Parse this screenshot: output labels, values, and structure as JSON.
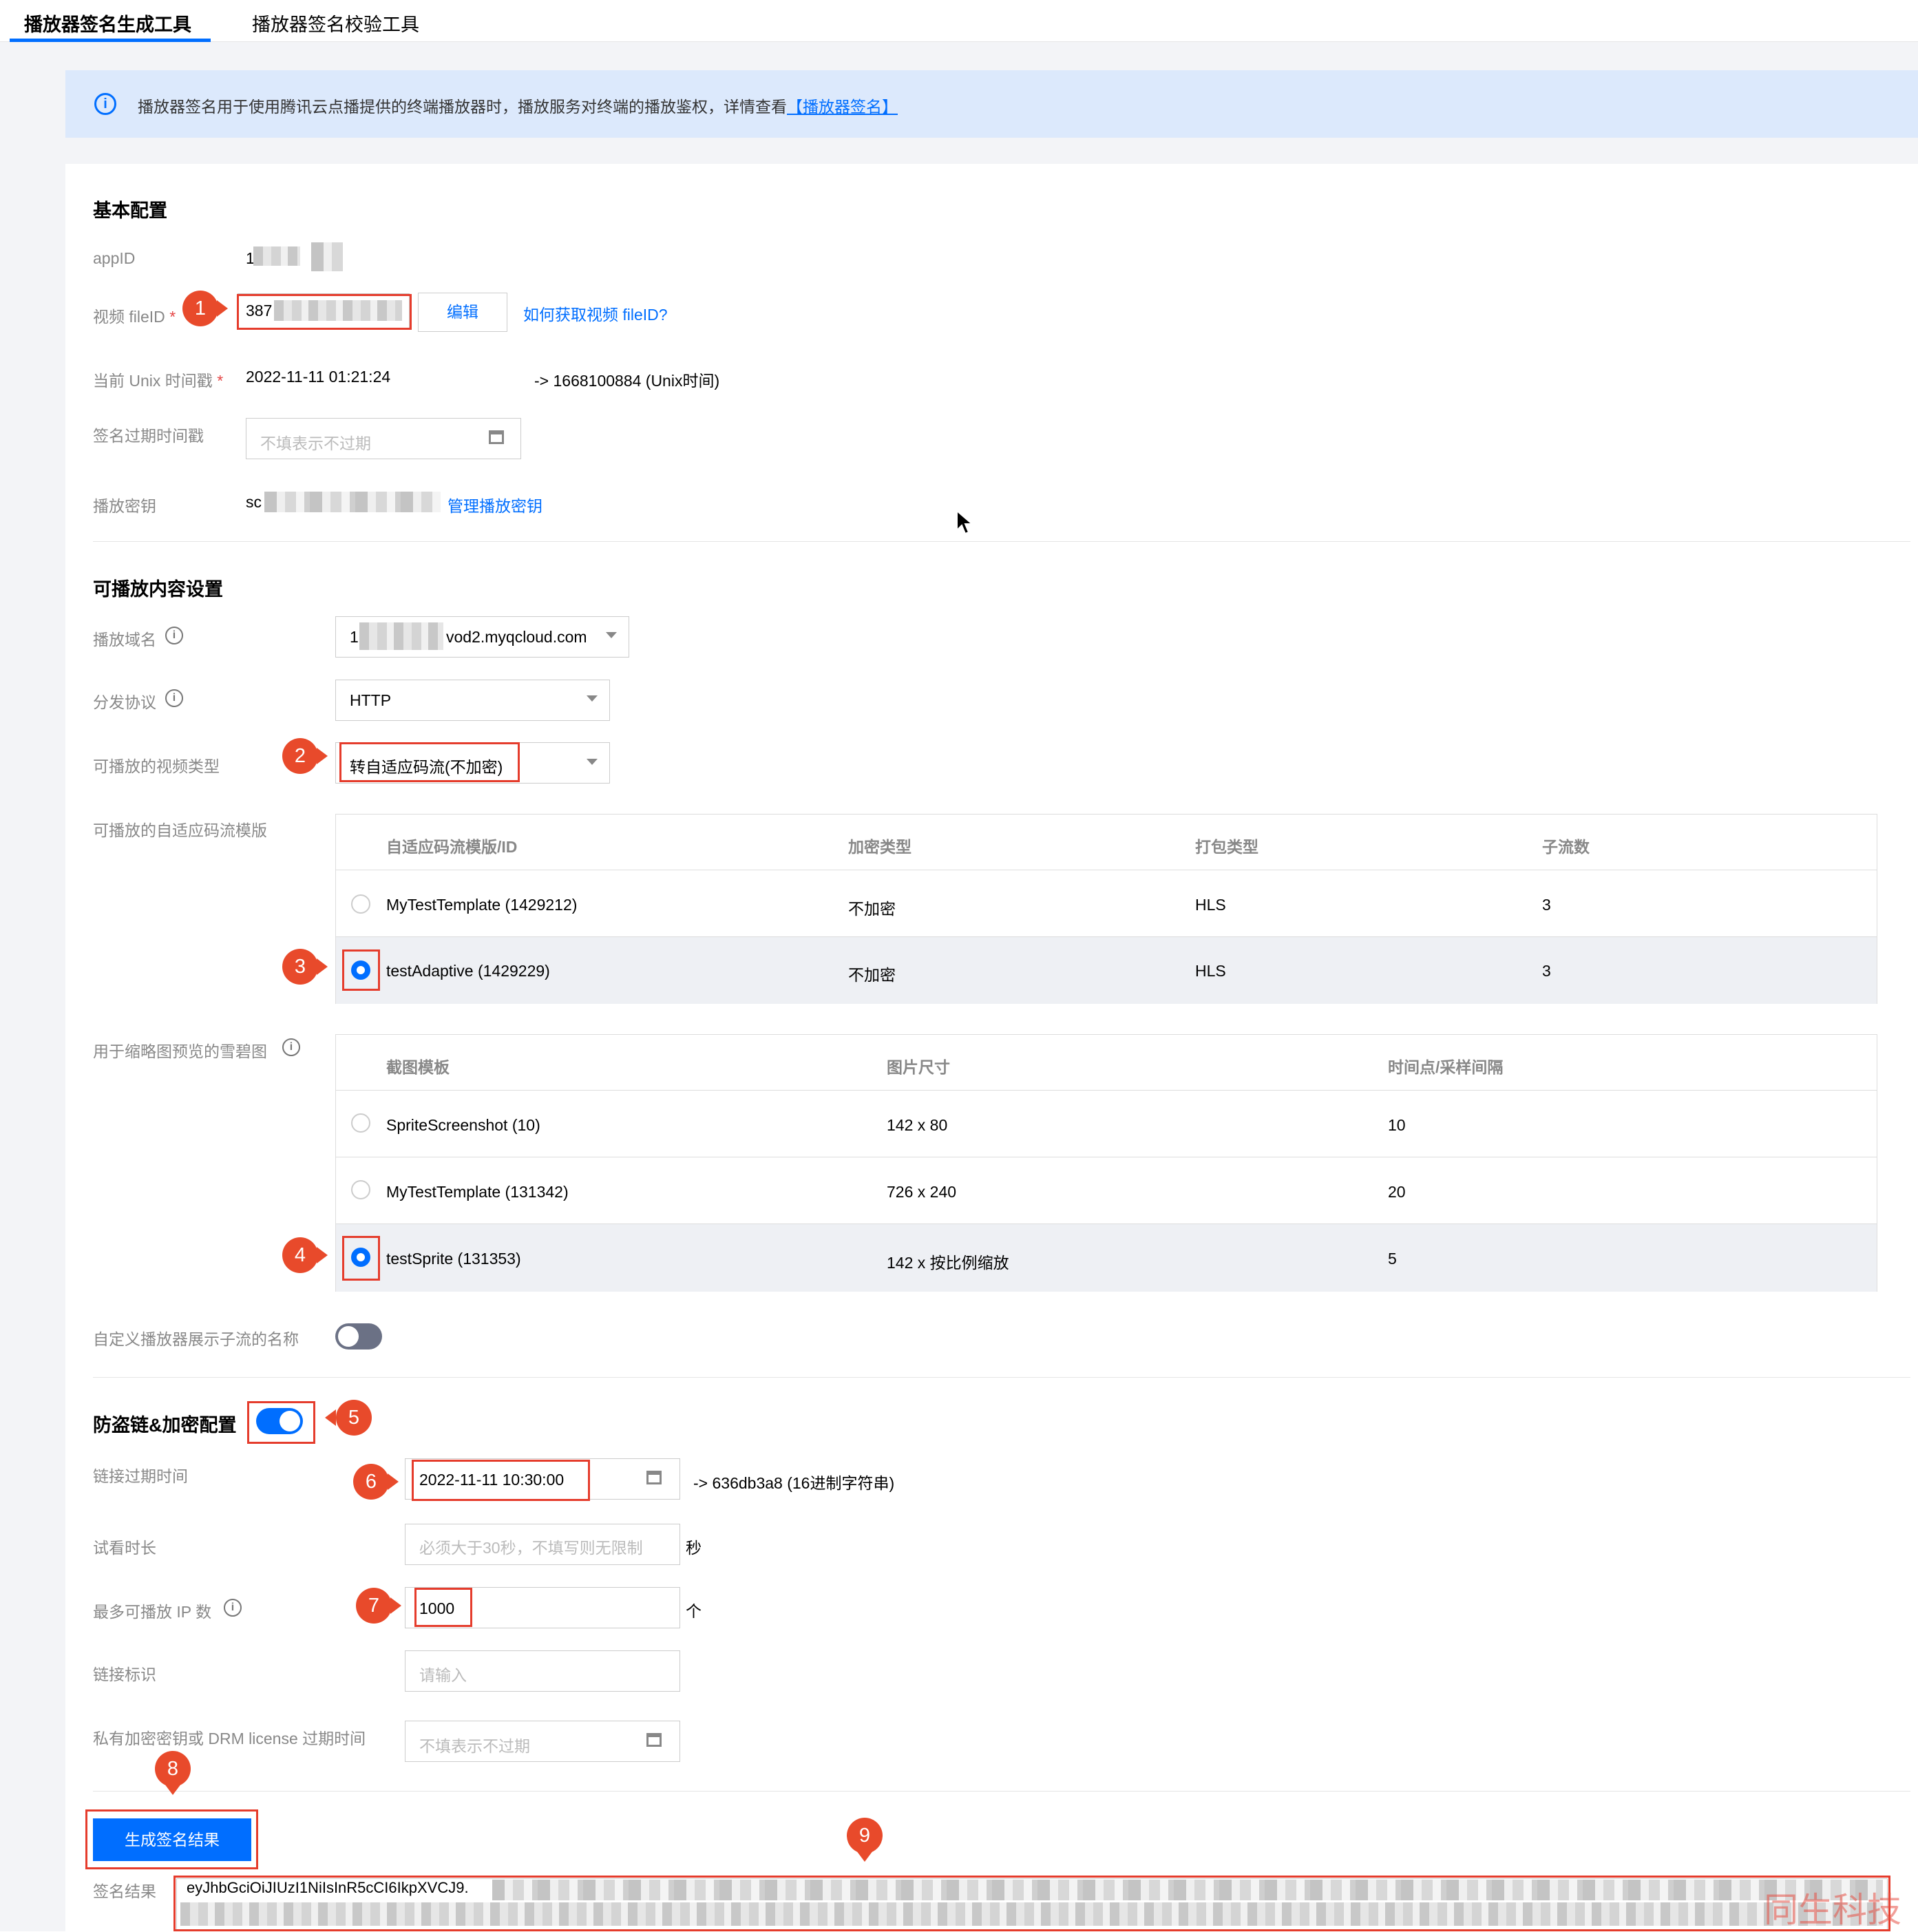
{
  "tabs": {
    "active": "播放器签名生成工具",
    "other": "播放器签名校验工具"
  },
  "banner": {
    "text": "播放器签名用于使用腾讯云点播提供的终端播放器时，播放服务对终端的播放鉴权，详情查看",
    "link": "【播放器签名】"
  },
  "basic": {
    "title": "基本配置",
    "appid_label": "appID",
    "appid_value": "1",
    "fileid_label": "视频 fileID",
    "fileid_value": "387",
    "edit_button": "编辑",
    "fileid_help": "如何获取视频 fileID?",
    "unix_label": "当前 Unix 时间戳",
    "unix_value": "2022-11-11 01:21:24",
    "unix_converted": "-> 1668100884 (Unix时间)",
    "expire_label": "签名过期时间戳",
    "expire_placeholder": "不填表示不过期",
    "key_label": "播放密钥",
    "key_value": "sc",
    "key_manage": "管理播放密钥"
  },
  "content": {
    "title": "可播放内容设置",
    "domain_label": "播放域名",
    "domain_value_prefix": "1",
    "domain_value": "vod2.myqcloud.com",
    "protocol_label": "分发协议",
    "protocol_value": "HTTP",
    "type_label": "可播放的视频类型",
    "type_value": "转自适应码流(不加密)",
    "template_label": "可播放的自适应码流模版",
    "template_table": {
      "headers": [
        "自适应码流模版/ID",
        "加密类型",
        "打包类型",
        "子流数"
      ],
      "rows": [
        {
          "name": "MyTestTemplate (1429212)",
          "enc": "不加密",
          "pack": "HLS",
          "streams": "3",
          "selected": false
        },
        {
          "name": "testAdaptive (1429229)",
          "enc": "不加密",
          "pack": "HLS",
          "streams": "3",
          "selected": true
        }
      ]
    },
    "sprite_label": "用于缩略图预览的雪碧图",
    "sprite_table": {
      "headers": [
        "截图模板",
        "图片尺寸",
        "时间点/采样间隔"
      ],
      "rows": [
        {
          "name": "SpriteScreenshot (10)",
          "size": "142 x 80",
          "interval": "10",
          "selected": false
        },
        {
          "name": "MyTestTemplate (131342)",
          "size": "726 x 240",
          "interval": "20",
          "selected": false
        },
        {
          "name": "testSprite (131353)",
          "size": "142 x 按比例缩放",
          "interval": "5",
          "selected": true
        }
      ]
    },
    "custom_name_label": "自定义播放器展示子流的名称",
    "custom_name_toggle": "off"
  },
  "security": {
    "title": "防盗链&加密配置",
    "toggle": "on",
    "link_expire_label": "链接过期时间",
    "link_expire_value": "2022-11-11 10:30:00",
    "link_expire_hex": "-> 636db3a8 (16进制字符串)",
    "trial_label": "试看时长",
    "trial_placeholder": "必须大于30秒，不填写则无限制",
    "trial_unit": "秒",
    "maxip_label": "最多可播放 IP 数",
    "maxip_value": "1000",
    "maxip_unit": "个",
    "linkid_label": "链接标识",
    "linkid_placeholder": "请输入",
    "drm_label": "私有加密密钥或 DRM license 过期时间",
    "drm_placeholder": "不填表示不过期"
  },
  "generate_button": "生成签名结果",
  "result": {
    "label": "签名结果",
    "value": "eyJhbGciOiJIUzI1NiIsInR5cCI6IkpXVCJ9."
  },
  "badges": [
    "1",
    "2",
    "3",
    "4",
    "5",
    "6",
    "7",
    "8",
    "9"
  ],
  "watermark": "同生科技",
  "colors": {
    "accent": "#006eff",
    "annotation": "#e84a2b",
    "banner_bg": "#dce9fc"
  }
}
